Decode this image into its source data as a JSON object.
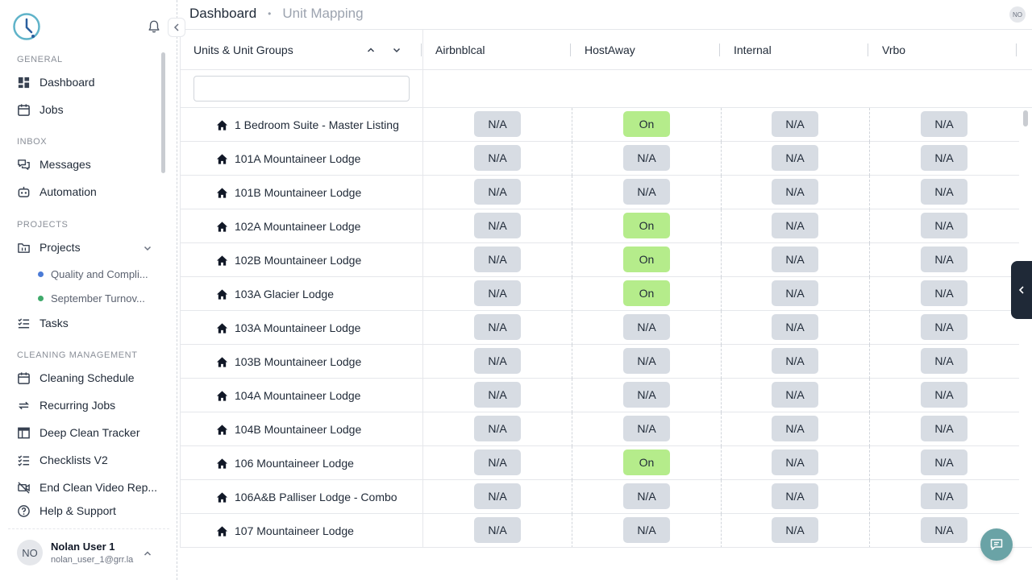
{
  "sidebar": {
    "sections": {
      "general": "GENERAL",
      "inbox": "INBOX",
      "projects": "PROJECTS",
      "cleaning": "CLEANING MANAGEMENT"
    },
    "items": {
      "dashboard": "Dashboard",
      "jobs": "Jobs",
      "messages": "Messages",
      "automation": "Automation",
      "projects": "Projects",
      "tasks": "Tasks",
      "cleaning_schedule": "Cleaning Schedule",
      "recurring_jobs": "Recurring Jobs",
      "deep_clean": "Deep Clean Tracker",
      "checklists": "Checklists V2",
      "end_clean": "End Clean Video Rep...",
      "help": "Help & Support"
    },
    "sub_projects": [
      {
        "label": "Quality and Compli...",
        "color": "#4b7bd6"
      },
      {
        "label": "September Turnov...",
        "color": "#3faa6b"
      }
    ],
    "user": {
      "initials": "NO",
      "name": "Nolan User 1",
      "email": "nolan_user_1@grr.la"
    }
  },
  "header": {
    "breadcrumb_main": "Dashboard",
    "breadcrumb_sep": "•",
    "breadcrumb_sub": "Unit Mapping",
    "avatar_initials": "NO"
  },
  "table": {
    "first_column": "Units & Unit Groups",
    "channels": [
      "Airbnblcal",
      "HostAway",
      "Internal",
      "Vrbo"
    ],
    "rows": [
      {
        "name": "1 Bedroom Suite - Master Listing",
        "values": [
          "N/A",
          "On",
          "N/A",
          "N/A"
        ]
      },
      {
        "name": "101A Mountaineer Lodge",
        "values": [
          "N/A",
          "N/A",
          "N/A",
          "N/A"
        ]
      },
      {
        "name": "101B Mountaineer Lodge",
        "values": [
          "N/A",
          "N/A",
          "N/A",
          "N/A"
        ]
      },
      {
        "name": "102A Mountaineer Lodge",
        "values": [
          "N/A",
          "On",
          "N/A",
          "N/A"
        ]
      },
      {
        "name": "102B Mountaineer Lodge",
        "values": [
          "N/A",
          "On",
          "N/A",
          "N/A"
        ]
      },
      {
        "name": "103A Glacier Lodge",
        "values": [
          "N/A",
          "On",
          "N/A",
          "N/A"
        ]
      },
      {
        "name": "103A Mountaineer Lodge",
        "values": [
          "N/A",
          "N/A",
          "N/A",
          "N/A"
        ]
      },
      {
        "name": "103B Mountaineer Lodge",
        "values": [
          "N/A",
          "N/A",
          "N/A",
          "N/A"
        ]
      },
      {
        "name": "104A Mountaineer Lodge",
        "values": [
          "N/A",
          "N/A",
          "N/A",
          "N/A"
        ]
      },
      {
        "name": "104B Mountaineer Lodge",
        "values": [
          "N/A",
          "N/A",
          "N/A",
          "N/A"
        ]
      },
      {
        "name": "106 Mountaineer Lodge",
        "values": [
          "N/A",
          "On",
          "N/A",
          "N/A"
        ]
      },
      {
        "name": "106A&B Palliser Lodge - Combo",
        "values": [
          "N/A",
          "N/A",
          "N/A",
          "N/A"
        ]
      },
      {
        "name": "107 Mountaineer Lodge",
        "values": [
          "N/A",
          "N/A",
          "N/A",
          "N/A"
        ]
      }
    ]
  },
  "colors": {
    "on_badge": "#b5ec8b",
    "na_badge": "#d7dce3",
    "chat_button": "#6aa3a6",
    "side_tab": "#1f2937"
  }
}
